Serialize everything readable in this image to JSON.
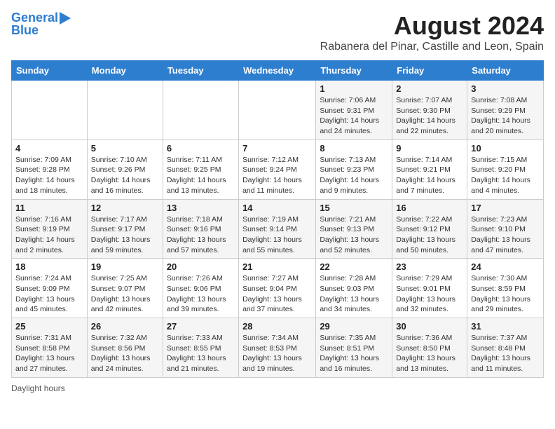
{
  "header": {
    "logo_line1": "General",
    "logo_line2": "Blue",
    "main_title": "August 2024",
    "subtitle": "Rabanera del Pinar, Castille and Leon, Spain"
  },
  "columns": [
    "Sunday",
    "Monday",
    "Tuesday",
    "Wednesday",
    "Thursday",
    "Friday",
    "Saturday"
  ],
  "weeks": [
    [
      {
        "day": "",
        "info": ""
      },
      {
        "day": "",
        "info": ""
      },
      {
        "day": "",
        "info": ""
      },
      {
        "day": "",
        "info": ""
      },
      {
        "day": "1",
        "info": "Sunrise: 7:06 AM\nSunset: 9:31 PM\nDaylight: 14 hours and 24 minutes."
      },
      {
        "day": "2",
        "info": "Sunrise: 7:07 AM\nSunset: 9:30 PM\nDaylight: 14 hours and 22 minutes."
      },
      {
        "day": "3",
        "info": "Sunrise: 7:08 AM\nSunset: 9:29 PM\nDaylight: 14 hours and 20 minutes."
      }
    ],
    [
      {
        "day": "4",
        "info": "Sunrise: 7:09 AM\nSunset: 9:28 PM\nDaylight: 14 hours and 18 minutes."
      },
      {
        "day": "5",
        "info": "Sunrise: 7:10 AM\nSunset: 9:26 PM\nDaylight: 14 hours and 16 minutes."
      },
      {
        "day": "6",
        "info": "Sunrise: 7:11 AM\nSunset: 9:25 PM\nDaylight: 14 hours and 13 minutes."
      },
      {
        "day": "7",
        "info": "Sunrise: 7:12 AM\nSunset: 9:24 PM\nDaylight: 14 hours and 11 minutes."
      },
      {
        "day": "8",
        "info": "Sunrise: 7:13 AM\nSunset: 9:23 PM\nDaylight: 14 hours and 9 minutes."
      },
      {
        "day": "9",
        "info": "Sunrise: 7:14 AM\nSunset: 9:21 PM\nDaylight: 14 hours and 7 minutes."
      },
      {
        "day": "10",
        "info": "Sunrise: 7:15 AM\nSunset: 9:20 PM\nDaylight: 14 hours and 4 minutes."
      }
    ],
    [
      {
        "day": "11",
        "info": "Sunrise: 7:16 AM\nSunset: 9:19 PM\nDaylight: 14 hours and 2 minutes."
      },
      {
        "day": "12",
        "info": "Sunrise: 7:17 AM\nSunset: 9:17 PM\nDaylight: 13 hours and 59 minutes."
      },
      {
        "day": "13",
        "info": "Sunrise: 7:18 AM\nSunset: 9:16 PM\nDaylight: 13 hours and 57 minutes."
      },
      {
        "day": "14",
        "info": "Sunrise: 7:19 AM\nSunset: 9:14 PM\nDaylight: 13 hours and 55 minutes."
      },
      {
        "day": "15",
        "info": "Sunrise: 7:21 AM\nSunset: 9:13 PM\nDaylight: 13 hours and 52 minutes."
      },
      {
        "day": "16",
        "info": "Sunrise: 7:22 AM\nSunset: 9:12 PM\nDaylight: 13 hours and 50 minutes."
      },
      {
        "day": "17",
        "info": "Sunrise: 7:23 AM\nSunset: 9:10 PM\nDaylight: 13 hours and 47 minutes."
      }
    ],
    [
      {
        "day": "18",
        "info": "Sunrise: 7:24 AM\nSunset: 9:09 PM\nDaylight: 13 hours and 45 minutes."
      },
      {
        "day": "19",
        "info": "Sunrise: 7:25 AM\nSunset: 9:07 PM\nDaylight: 13 hours and 42 minutes."
      },
      {
        "day": "20",
        "info": "Sunrise: 7:26 AM\nSunset: 9:06 PM\nDaylight: 13 hours and 39 minutes."
      },
      {
        "day": "21",
        "info": "Sunrise: 7:27 AM\nSunset: 9:04 PM\nDaylight: 13 hours and 37 minutes."
      },
      {
        "day": "22",
        "info": "Sunrise: 7:28 AM\nSunset: 9:03 PM\nDaylight: 13 hours and 34 minutes."
      },
      {
        "day": "23",
        "info": "Sunrise: 7:29 AM\nSunset: 9:01 PM\nDaylight: 13 hours and 32 minutes."
      },
      {
        "day": "24",
        "info": "Sunrise: 7:30 AM\nSunset: 8:59 PM\nDaylight: 13 hours and 29 minutes."
      }
    ],
    [
      {
        "day": "25",
        "info": "Sunrise: 7:31 AM\nSunset: 8:58 PM\nDaylight: 13 hours and 27 minutes."
      },
      {
        "day": "26",
        "info": "Sunrise: 7:32 AM\nSunset: 8:56 PM\nDaylight: 13 hours and 24 minutes."
      },
      {
        "day": "27",
        "info": "Sunrise: 7:33 AM\nSunset: 8:55 PM\nDaylight: 13 hours and 21 minutes."
      },
      {
        "day": "28",
        "info": "Sunrise: 7:34 AM\nSunset: 8:53 PM\nDaylight: 13 hours and 19 minutes."
      },
      {
        "day": "29",
        "info": "Sunrise: 7:35 AM\nSunset: 8:51 PM\nDaylight: 13 hours and 16 minutes."
      },
      {
        "day": "30",
        "info": "Sunrise: 7:36 AM\nSunset: 8:50 PM\nDaylight: 13 hours and 13 minutes."
      },
      {
        "day": "31",
        "info": "Sunrise: 7:37 AM\nSunset: 8:48 PM\nDaylight: 13 hours and 11 minutes."
      }
    ]
  ],
  "footer": {
    "daylight_label": "Daylight hours"
  }
}
